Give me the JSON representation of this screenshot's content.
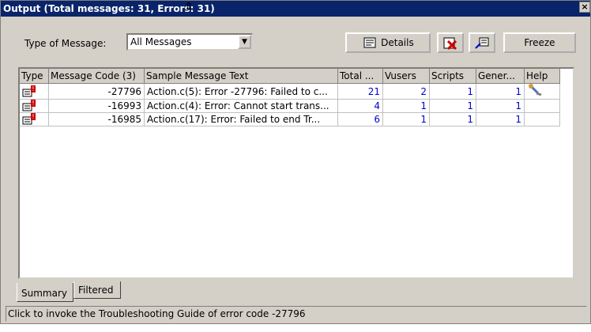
{
  "window": {
    "title": "Output (Total messages: 31, Errors: 31)",
    "close_glyph": "×"
  },
  "toolbar": {
    "type_label": "Type of Message:",
    "type_value": "All Messages",
    "details_label": "Details",
    "freeze_label": "Freeze"
  },
  "grid": {
    "columns": [
      "Type",
      "Message Code (3)",
      "Sample Message Text",
      "Total ...",
      "Vusers",
      "Scripts",
      "Gener...",
      "Help"
    ],
    "rows": [
      {
        "code": "-27796",
        "text": "Action.c(5): Error -27796: Failed to c...",
        "total": "21",
        "vusers": "2",
        "scripts": "1",
        "generators": "1",
        "help_icon": "wrench-icon"
      },
      {
        "code": "-16993",
        "text": "Action.c(4): Error: Cannot start trans...",
        "total": "4",
        "vusers": "1",
        "scripts": "1",
        "generators": "1",
        "help_icon": ""
      },
      {
        "code": "-16985",
        "text": "Action.c(17): Error: Failed to end Tr...",
        "total": "6",
        "vusers": "1",
        "scripts": "1",
        "generators": "1",
        "help_icon": ""
      }
    ]
  },
  "tabs": [
    "Summary",
    "Filtered"
  ],
  "status": "Click to invoke the Troubleshooting Guide of error code -27796",
  "colors": {
    "titlebar": "#0a246a",
    "link": "#0000cc",
    "error": "#cc0000"
  }
}
